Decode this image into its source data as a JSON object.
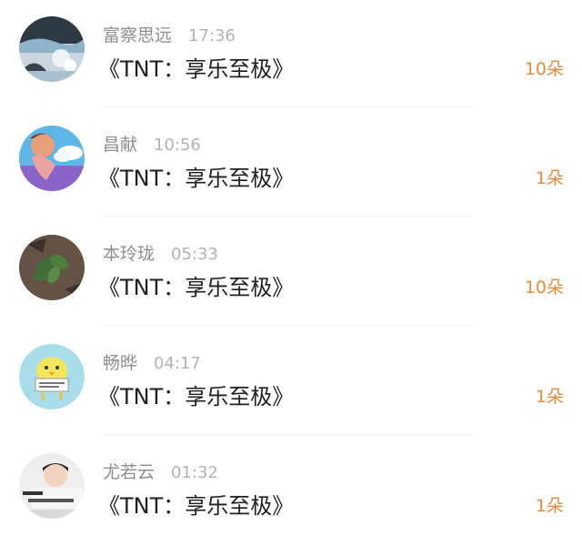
{
  "accent_color": "#e88a3a",
  "records": [
    {
      "name": "富察思远",
      "time": "17:36",
      "title": "《TNT：享乐至极》",
      "count": "10朵",
      "avatar": "avatar-icon"
    },
    {
      "name": "昌献",
      "time": "10:56",
      "title": "《TNT：享乐至极》",
      "count": "1朵",
      "avatar": "avatar-icon"
    },
    {
      "name": "本玲珑",
      "time": "05:33",
      "title": "《TNT：享乐至极》",
      "count": "10朵",
      "avatar": "avatar-icon"
    },
    {
      "name": "畅晔",
      "time": "04:17",
      "title": "《TNT：享乐至极》",
      "count": "1朵",
      "avatar": "avatar-icon"
    },
    {
      "name": "尤若云",
      "time": "01:32",
      "title": "《TNT：享乐至极》",
      "count": "1朵",
      "avatar": "avatar-icon"
    }
  ]
}
